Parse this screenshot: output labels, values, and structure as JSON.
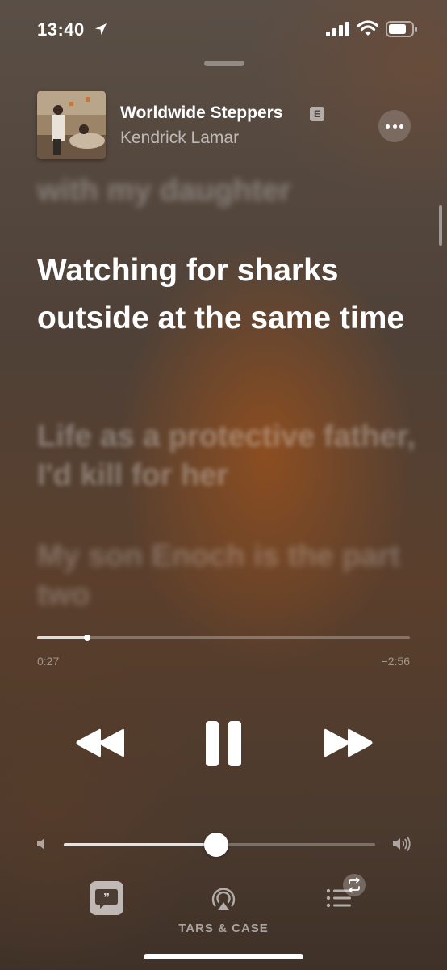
{
  "status_bar": {
    "time": "13:40",
    "icons": [
      "location-arrow-icon",
      "cellular-signal-icon",
      "wifi-icon",
      "battery-icon"
    ]
  },
  "now_playing": {
    "song_title": "Worldwide Steppers",
    "explicit_badge": "E",
    "artist": "Kendrick Lamar",
    "more_icon": "ellipsis-icon"
  },
  "lyrics": {
    "previous": "with my daughter",
    "current": "Watching for sharks outside at the same time",
    "next_1": "Life as a protective father, I'd kill for her",
    "next_2": "My son Enoch is the part two"
  },
  "playback": {
    "elapsed": "0:27",
    "remaining": "−2:56",
    "progress_fraction": 0.135,
    "volume_fraction": 0.49,
    "controls": [
      "rewind-icon",
      "pause-icon",
      "fast-forward-icon"
    ]
  },
  "bottom_bar": {
    "lyrics_icon": "lyrics-quote-icon",
    "airplay_icon": "airplay-audio-icon",
    "airplay_device": "TARS & CASE",
    "queue_icon": "queue-list-icon",
    "repeat_icon": "repeat-icon"
  },
  "colors": {
    "text": "#ffffff",
    "background_accent": "#965020"
  }
}
